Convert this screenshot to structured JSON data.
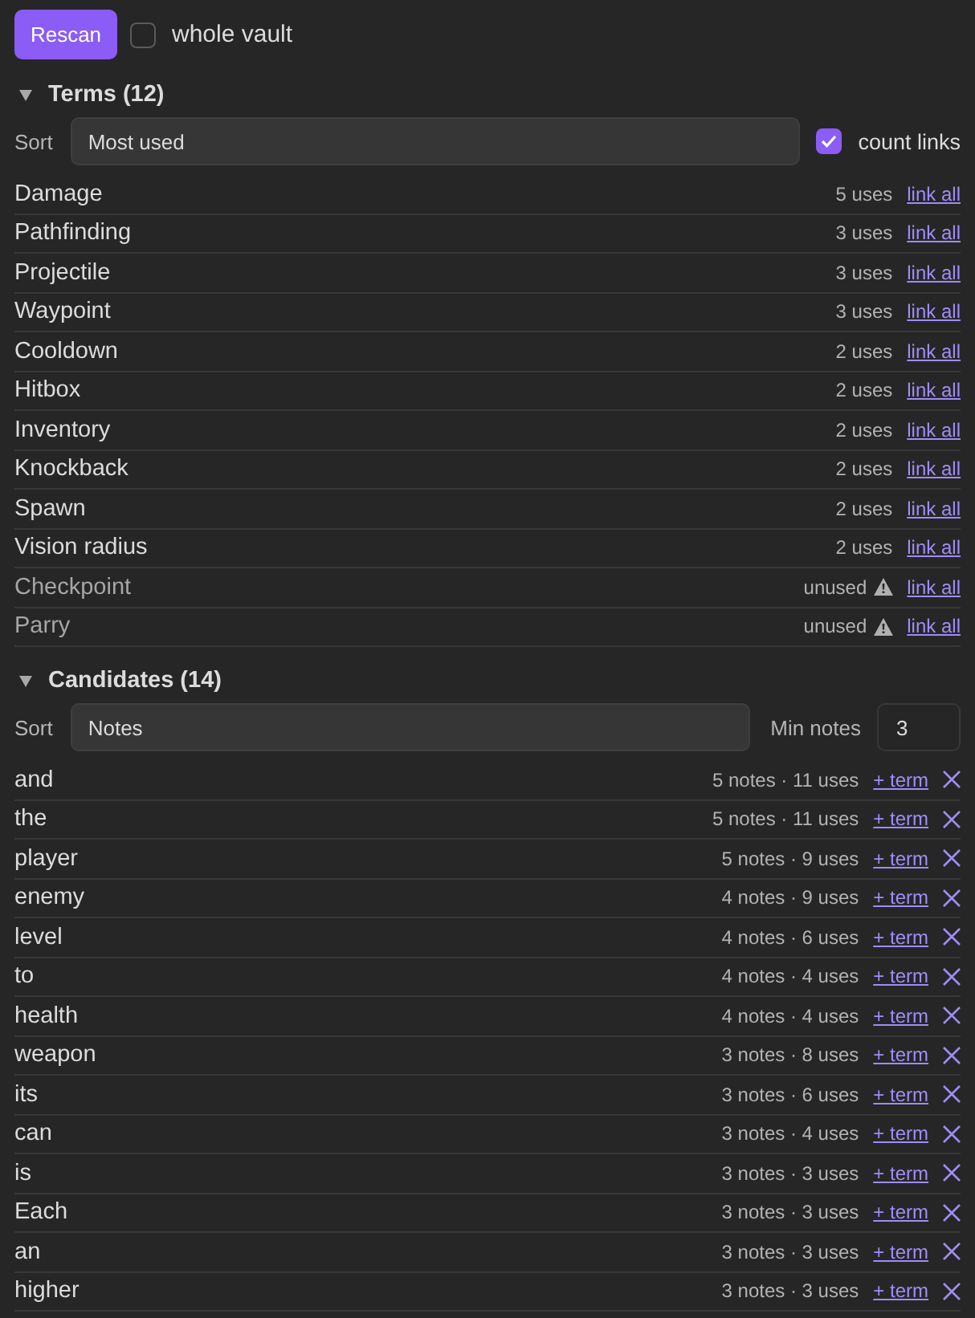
{
  "toolbar": {
    "rescan_button": "Rescan",
    "whole_vault": {
      "label": "whole vault",
      "checked": false
    }
  },
  "terms": {
    "title": "Terms (12)",
    "expanded": true,
    "sort_label": "Sort",
    "sort_value": "Most used",
    "count_links": {
      "label": "count links",
      "checked": true
    },
    "items": [
      {
        "name": "Damage",
        "usage": "5 uses",
        "unused": false,
        "action": "link all"
      },
      {
        "name": "Pathfinding",
        "usage": "3 uses",
        "unused": false,
        "action": "link all"
      },
      {
        "name": "Projectile",
        "usage": "3 uses",
        "unused": false,
        "action": "link all"
      },
      {
        "name": "Waypoint",
        "usage": "3 uses",
        "unused": false,
        "action": "link all"
      },
      {
        "name": "Cooldown",
        "usage": "2 uses",
        "unused": false,
        "action": "link all"
      },
      {
        "name": "Hitbox",
        "usage": "2 uses",
        "unused": false,
        "action": "link all"
      },
      {
        "name": "Inventory",
        "usage": "2 uses",
        "unused": false,
        "action": "link all"
      },
      {
        "name": "Knockback",
        "usage": "2 uses",
        "unused": false,
        "action": "link all"
      },
      {
        "name": "Spawn",
        "usage": "2 uses",
        "unused": false,
        "action": "link all"
      },
      {
        "name": "Vision radius",
        "usage": "2 uses",
        "unused": false,
        "action": "link all"
      },
      {
        "name": "Checkpoint",
        "usage": "unused",
        "unused": true,
        "action": "link all"
      },
      {
        "name": "Parry",
        "usage": "unused",
        "unused": true,
        "action": "link all"
      }
    ]
  },
  "candidates": {
    "title": "Candidates (14)",
    "expanded": true,
    "sort_label": "Sort",
    "sort_value": "Notes",
    "min_notes_label": "Min notes",
    "min_notes_value": "3",
    "items": [
      {
        "word": "and",
        "stats": "5 notes · 11 uses",
        "action": "+ term"
      },
      {
        "word": "the",
        "stats": "5 notes · 11 uses",
        "action": "+ term"
      },
      {
        "word": "player",
        "stats": "5 notes · 9 uses",
        "action": "+ term"
      },
      {
        "word": "enemy",
        "stats": "4 notes · 9 uses",
        "action": "+ term"
      },
      {
        "word": "level",
        "stats": "4 notes · 6 uses",
        "action": "+ term"
      },
      {
        "word": "to",
        "stats": "4 notes · 4 uses",
        "action": "+ term"
      },
      {
        "word": "health",
        "stats": "4 notes · 4 uses",
        "action": "+ term"
      },
      {
        "word": "weapon",
        "stats": "3 notes · 8 uses",
        "action": "+ term"
      },
      {
        "word": "its",
        "stats": "3 notes · 6 uses",
        "action": "+ term"
      },
      {
        "word": "can",
        "stats": "3 notes · 4 uses",
        "action": "+ term"
      },
      {
        "word": "is",
        "stats": "3 notes · 3 uses",
        "action": "+ term"
      },
      {
        "word": "Each",
        "stats": "3 notes · 3 uses",
        "action": "+ term"
      },
      {
        "word": "an",
        "stats": "3 notes · 3 uses",
        "action": "+ term"
      },
      {
        "word": "higher",
        "stats": "3 notes · 3 uses",
        "action": "+ term"
      }
    ]
  }
}
